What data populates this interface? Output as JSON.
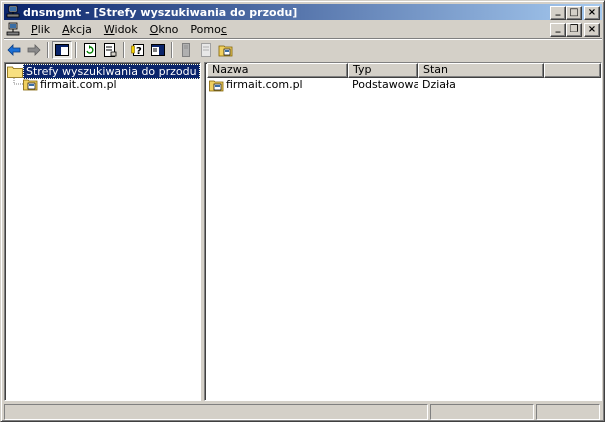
{
  "window": {
    "title": "dnsmgmt - [Strefy wyszukiwania do przodu]",
    "title_buttons": [
      "_",
      "□",
      "×"
    ],
    "mdi_buttons": [
      "_",
      "❐",
      "×"
    ]
  },
  "menu": {
    "items": [
      {
        "label": "Plik",
        "accel": "P",
        "rest": "lik"
      },
      {
        "label": "Akcja",
        "accel": "A",
        "rest": "kcja"
      },
      {
        "label": "Widok",
        "accel": "W",
        "rest": "idok"
      },
      {
        "label": "Okno",
        "accel": "O",
        "rest": "kno"
      },
      {
        "label": "Pomoc",
        "pre": "Pomo",
        "accel": "c"
      }
    ]
  },
  "toolbar": {
    "buttons": [
      "back-icon",
      "forward-icon",
      "show-hide-tree-icon",
      "refresh-icon",
      "export-list-icon",
      "help-icon",
      "show-hide-action-pane-icon",
      "new-zone-icon",
      "properties-icon",
      "configure-server-icon"
    ]
  },
  "tree": {
    "root": {
      "label": "Strefy wyszukiwania do przodu",
      "icon": "folder-icon",
      "selected": true
    },
    "children": [
      {
        "label": "firmait.com.pl",
        "icon": "zone-icon"
      }
    ]
  },
  "list": {
    "columns": [
      "Nazwa",
      "Typ",
      "Stan"
    ],
    "rows": [
      {
        "name": "firmait.com.pl",
        "type": "Podstawowa ...",
        "status": "Działa",
        "icon": "zone-icon"
      }
    ]
  },
  "statusbar": {
    "panels": [
      "",
      "",
      ""
    ]
  }
}
